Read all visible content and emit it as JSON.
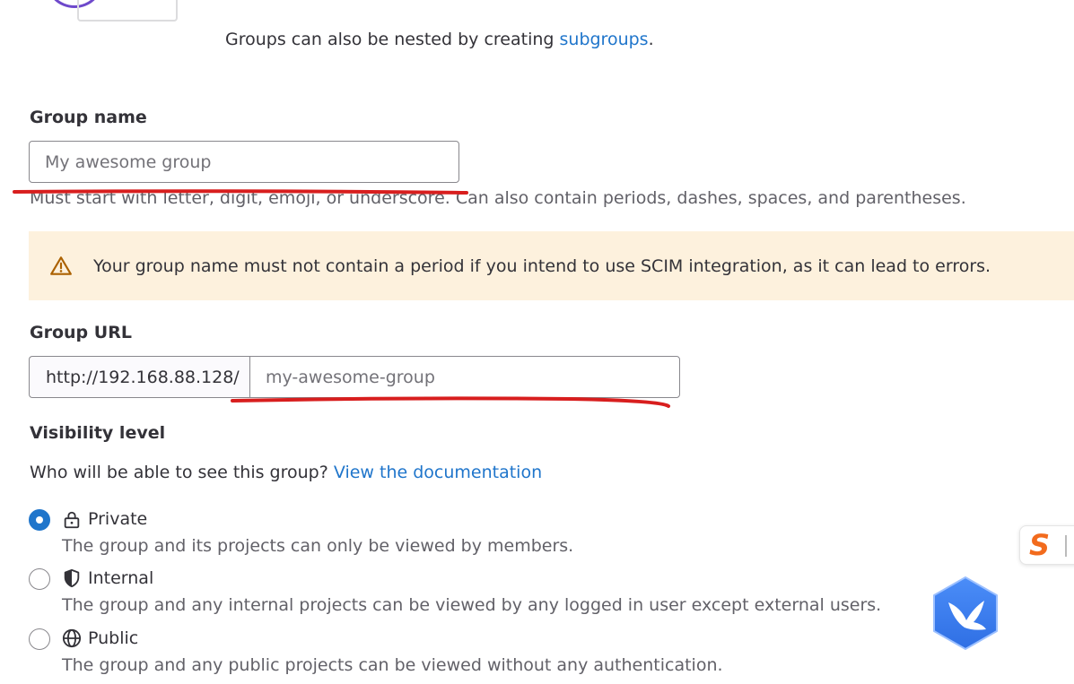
{
  "intro": {
    "nested_prefix": "Groups can also be nested by creating ",
    "subgroups_link": "subgroups",
    "nested_suffix": "."
  },
  "group_name": {
    "label": "Group name",
    "placeholder": "My awesome group",
    "value": "",
    "help": "Must start with letter, digit, emoji, or underscore. Can also contain periods, dashes, spaces, and parentheses."
  },
  "alert": {
    "icon": "warning-icon",
    "text": "Your group name must not contain a period if you intend to use SCIM integration, as it can lead to errors."
  },
  "group_url": {
    "label": "Group URL",
    "prefix": "http://192.168.88.128/",
    "placeholder": "my-awesome-group",
    "value": ""
  },
  "visibility": {
    "label": "Visibility level",
    "question": "Who will be able to see this group?",
    "doc_link": "View the documentation",
    "options": [
      {
        "label": "Private",
        "icon": "lock-icon",
        "description": "The group and its projects can only be viewed by members.",
        "checked": true
      },
      {
        "label": "Internal",
        "icon": "shield-icon",
        "description": "The group and any internal projects can be viewed by any logged in user except external users.",
        "checked": false
      },
      {
        "label": "Public",
        "icon": "globe-icon",
        "description": "The group and any public projects can be viewed without any authentication.",
        "checked": false
      }
    ]
  },
  "colors": {
    "link": "#1f75cb",
    "alert_bg": "#fdf1dd",
    "annotation_red": "#d81e1e",
    "radio_checked": "#1f75cb"
  },
  "overlays": {
    "side_tab_icon": "sogou-s-icon",
    "floating_icon": "bird-hexagon-icon"
  }
}
